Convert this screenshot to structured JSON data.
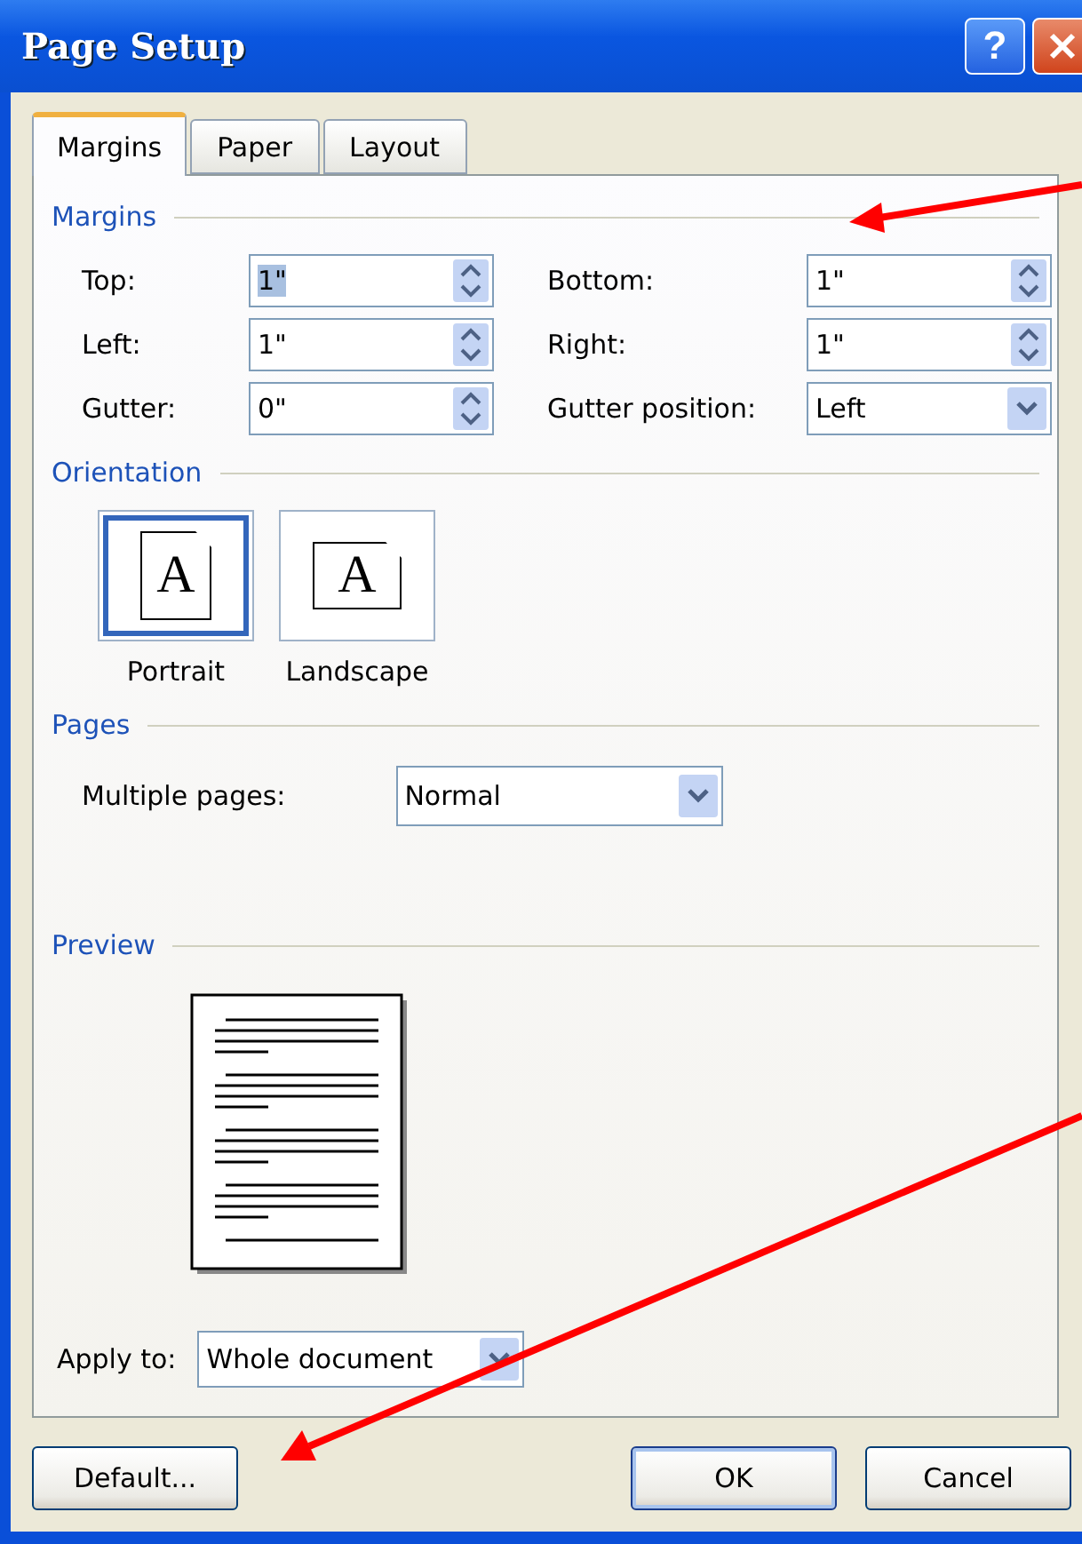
{
  "window": {
    "title": "Page Setup",
    "help_button": "?"
  },
  "tabs": [
    {
      "label": "Margins",
      "selected": true
    },
    {
      "label": "Paper",
      "selected": false
    },
    {
      "label": "Layout",
      "selected": false
    }
  ],
  "margins": {
    "heading": "Margins",
    "fields": [
      {
        "label": "Top:",
        "value": "1\"",
        "kind": "spin",
        "text_selected": true
      },
      {
        "label": "Bottom:",
        "value": "1\"",
        "kind": "spin",
        "text_selected": false
      },
      {
        "label": "Left:",
        "value": "1\"",
        "kind": "spin",
        "text_selected": false
      },
      {
        "label": "Right:",
        "value": "1\"",
        "kind": "spin",
        "text_selected": false
      },
      {
        "label": "Gutter:",
        "value": "0\"",
        "kind": "spin",
        "text_selected": false
      },
      {
        "label": "Gutter position:",
        "value": "Left",
        "kind": "dropdown",
        "text_selected": false
      }
    ]
  },
  "orientation": {
    "heading": "Orientation",
    "options": [
      {
        "label": "Portrait",
        "icon_letter": "A",
        "selected": true
      },
      {
        "label": "Landscape",
        "icon_letter": "A",
        "selected": false
      }
    ]
  },
  "pages": {
    "heading": "Pages",
    "label": "Multiple pages:",
    "value": "Normal"
  },
  "preview": {
    "heading": "Preview",
    "apply_label": "Apply to:",
    "apply_value": "Whole document"
  },
  "buttons": [
    {
      "label": "Default...",
      "default": false
    },
    {
      "label": "OK",
      "default": true
    },
    {
      "label": "Cancel",
      "default": false
    }
  ]
}
